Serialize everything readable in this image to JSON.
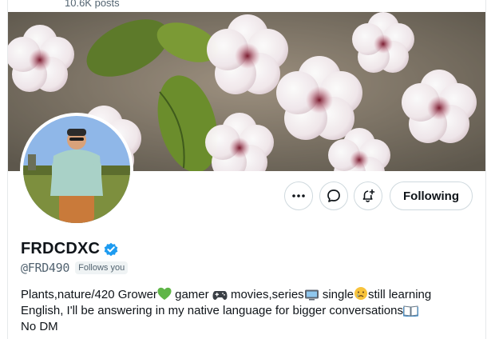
{
  "header": {
    "posts_count": "10.6K posts"
  },
  "profile": {
    "display_name": "FRDCDXC",
    "handle": "@FRD490",
    "follows_you_badge": "Follows you",
    "verified": true
  },
  "actions": {
    "more_icon": "more-horizontal-icon",
    "message_icon": "message-bubble-icon",
    "notify_icon": "bell-plus-icon",
    "following_label": "Following"
  },
  "bio": {
    "line1_a": "Plants,nature/420 Grower",
    "line1_b": " gamer ",
    "line1_c": " movies,series",
    "line1_d": " single",
    "line1_e": "still learning",
    "line2_a": "English, I'll be answering in my native language for bigger conversations",
    "line3": "No DM"
  },
  "colors": {
    "verified_blue": "#1d9bf0",
    "text_primary": "#0f1419",
    "text_secondary": "#536471",
    "border": "#cfd9de",
    "heart_green": "#5fb547"
  }
}
